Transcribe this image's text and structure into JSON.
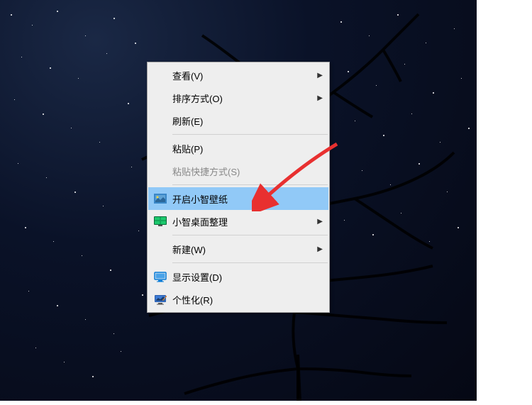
{
  "context_menu": {
    "items": [
      {
        "label": "查看(V)",
        "has_submenu": true,
        "icon": null,
        "disabled": false,
        "highlighted": false
      },
      {
        "label": "排序方式(O)",
        "has_submenu": true,
        "icon": null,
        "disabled": false,
        "highlighted": false
      },
      {
        "label": "刷新(E)",
        "has_submenu": false,
        "icon": null,
        "disabled": false,
        "highlighted": false
      },
      {
        "separator": true
      },
      {
        "label": "粘贴(P)",
        "has_submenu": false,
        "icon": null,
        "disabled": false,
        "highlighted": false
      },
      {
        "label": "粘贴快捷方式(S)",
        "has_submenu": false,
        "icon": null,
        "disabled": true,
        "highlighted": false
      },
      {
        "separator": true
      },
      {
        "label": "开启小智壁纸",
        "has_submenu": false,
        "icon": "wallpaper",
        "disabled": false,
        "highlighted": true
      },
      {
        "label": "小智桌面整理",
        "has_submenu": true,
        "icon": "desktop-organize",
        "disabled": false,
        "highlighted": false
      },
      {
        "separator": true
      },
      {
        "label": "新建(W)",
        "has_submenu": true,
        "icon": null,
        "disabled": false,
        "highlighted": false
      },
      {
        "separator": true
      },
      {
        "label": "显示设置(D)",
        "has_submenu": false,
        "icon": "display-settings",
        "disabled": false,
        "highlighted": false
      },
      {
        "label": "个性化(R)",
        "has_submenu": false,
        "icon": "personalize",
        "disabled": false,
        "highlighted": false
      }
    ]
  },
  "submenu_arrow": "▶",
  "background": {
    "description": "starry-night-sky-with-bare-tree"
  }
}
